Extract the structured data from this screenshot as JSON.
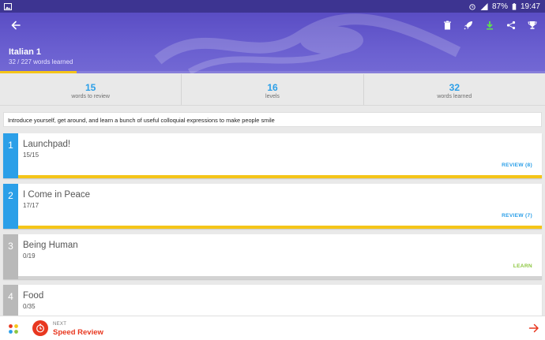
{
  "statusbar": {
    "battery": "87%",
    "time": "19:47"
  },
  "header": {
    "title": "Italian 1",
    "subtitle": "32 / 227 words learned",
    "progress": 0.141,
    "progress_color": "#f5c518",
    "icons": [
      "back-arrow-icon",
      "trash-icon",
      "rocket-icon",
      "download-icon",
      "share-icon",
      "trophy-icon"
    ]
  },
  "stats": [
    {
      "value": "15",
      "label": "words to review"
    },
    {
      "value": "16",
      "label": "levels"
    },
    {
      "value": "32",
      "label": "words learned"
    }
  ],
  "description": "Introduce yourself, get around, and learn a bunch of useful colloquial expressions to make people smile",
  "levels": [
    {
      "number": "1",
      "name": "Launchpad!",
      "count": "15/15",
      "action": "REVIEW (8)",
      "progress": 1.0,
      "accent": "#2b9fe8",
      "bar_color": "#f5c518",
      "action_color": "#2b9fe8"
    },
    {
      "number": "2",
      "name": "I Come in Peace",
      "count": "17/17",
      "action": "REVIEW (7)",
      "progress": 1.0,
      "accent": "#2b9fe8",
      "bar_color": "#f5c518",
      "action_color": "#2b9fe8"
    },
    {
      "number": "3",
      "name": "Being Human",
      "count": "0/19",
      "action": "LEARN",
      "progress": 0.0,
      "accent": "#b9b9b9",
      "bar_color": "#f5c518",
      "action_color": "#8cc63f"
    },
    {
      "number": "4",
      "name": "Food",
      "count": "0/35",
      "action": "",
      "progress": 0.0,
      "accent": "#b9b9b9",
      "bar_color": "#f5c518",
      "action_color": "#8cc63f"
    }
  ],
  "bottom": {
    "next_label": "NEXT",
    "next_mode": "Speed Review",
    "accent": "#e8371f"
  }
}
